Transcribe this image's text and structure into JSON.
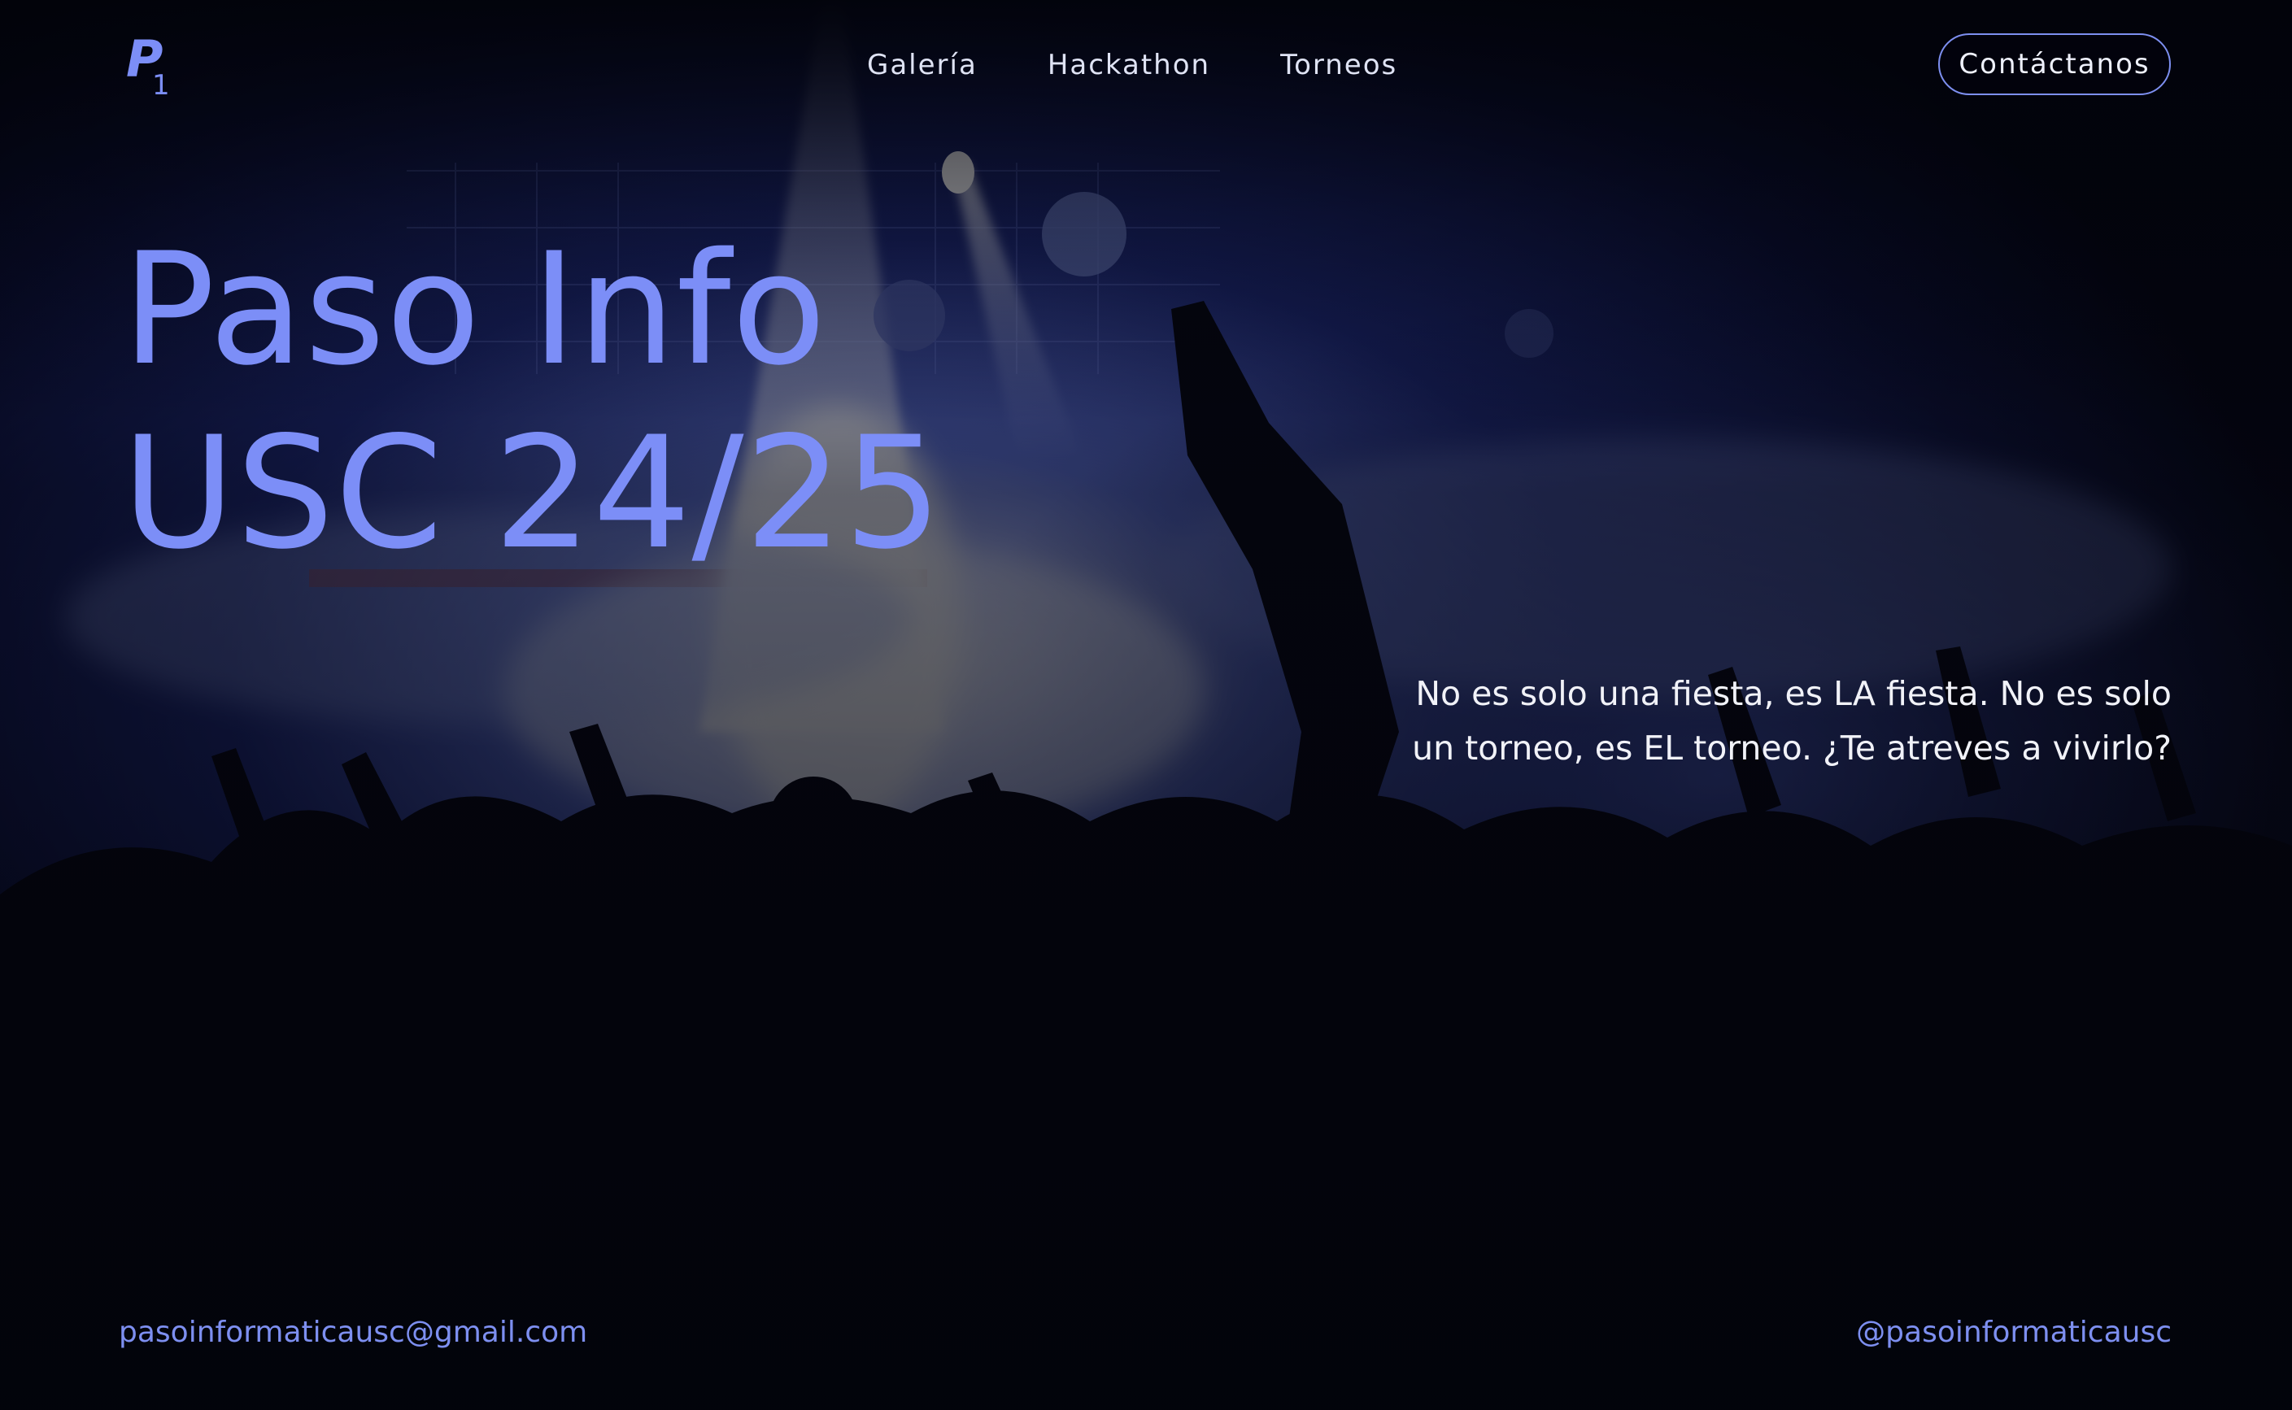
{
  "brand": {
    "logo_letter": "P",
    "logo_sub": "1"
  },
  "nav": {
    "items": [
      {
        "label": "Galería"
      },
      {
        "label": "Hackathon"
      },
      {
        "label": "Torneos"
      }
    ],
    "contact_label": "Contáctanos"
  },
  "hero": {
    "title_line1": "Paso Info",
    "title_line2": "USC 24/25",
    "tagline": "No es solo una fiesta, es LA fiesta. No es solo un torneo, es EL torneo. ¿Te atreves a vivirlo?"
  },
  "footer": {
    "email": "pasoinformaticausc@gmail.com",
    "social": "@pasoinformaticausc"
  },
  "colors": {
    "accent": "#7c8ef7",
    "background": "#03040c",
    "text": "#f1f2f8"
  }
}
